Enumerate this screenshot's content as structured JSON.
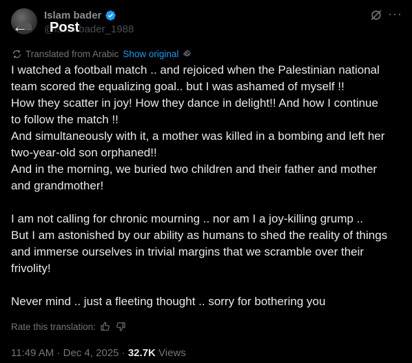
{
  "header": {
    "author_name": "Islam bader",
    "author_handle": "@islambader_1988",
    "title": "Post"
  },
  "translation": {
    "notice": "Translated from Arabic",
    "show_original": "Show original"
  },
  "tweet": {
    "lines": [
      "I watched a football match .. and rejoiced when the Palestinian national",
      "team scored the equalizing goal.. but I was ashamed of myself !!",
      "How they scatter in joy! How they dance in delight!! And how I continue",
      "to follow the match !!",
      "And simultaneously with it, a mother was killed in a bombing and left her",
      "two-year-old son orphaned!!",
      "And in the morning, we buried two children and their father and mother",
      "and grandmother!",
      "I am not calling for chronic mourning .. nor am I a joy-killing grump ..",
      "But I am astonished by our ability as humans to shed the reality of things",
      "and immerse ourselves in trivial margins that we scramble over their",
      "frivolity!",
      "Never mind .. just a fleeting thought .. sorry for bothering you"
    ]
  },
  "rate": {
    "label": "Rate this translation:"
  },
  "meta": {
    "time": "11:49 AM",
    "separator": "·",
    "date": "Dec 4, 2025",
    "views_count": "32.7K",
    "views_label": "Views"
  },
  "icons": {
    "back": "arrow-left-icon",
    "verified": "verified-badge-icon",
    "grok": "grok-icon",
    "more": "more-icon",
    "translate": "translate-icon",
    "settings": "gear-icon",
    "thumbs_up": "thumbs-up-icon",
    "thumbs_down": "thumbs-down-icon"
  },
  "colors": {
    "background": "#000000",
    "text": "#e7e9ea",
    "muted": "#71767b",
    "accent": "#1d9bf0"
  }
}
